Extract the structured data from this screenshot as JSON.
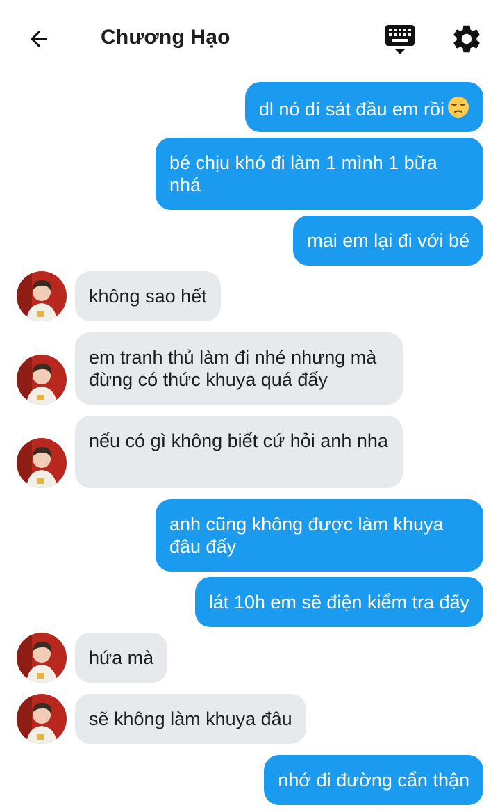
{
  "header": {
    "title": "Chương Hạo",
    "back_icon": "arrow-left-icon",
    "keyboard_icon": "keyboard-icon",
    "settings_icon": "gear-icon"
  },
  "colors": {
    "outgoing_bubble": "#1a9bf0",
    "incoming_bubble": "#e7eaed"
  },
  "messages": [
    {
      "from": "me",
      "text": "dl nó dí sát đầu em rồi",
      "emoji": "pensive-face"
    },
    {
      "from": "me",
      "text": "bé chịu khó đi làm 1 mình 1 bữa nhá"
    },
    {
      "from": "me",
      "text": "mai em lại đi với bé"
    },
    {
      "from": "contact",
      "text": "không sao hết"
    },
    {
      "from": "contact",
      "text": "em tranh thủ làm đi nhé nhưng mà đừng có thức khuya quá đấy"
    },
    {
      "from": "contact",
      "text": "nếu có gì không biết cứ hỏi anh nha"
    },
    {
      "from": "me",
      "text": "anh cũng không được làm khuya đâu đấy"
    },
    {
      "from": "me",
      "text": "lát 10h em sẽ điện kiểm tra đấy"
    },
    {
      "from": "contact",
      "text": "hứa mà"
    },
    {
      "from": "contact",
      "text": "sẽ không làm khuya đâu"
    },
    {
      "from": "me",
      "text": "nhớ đi đường cẩn thận"
    }
  ]
}
